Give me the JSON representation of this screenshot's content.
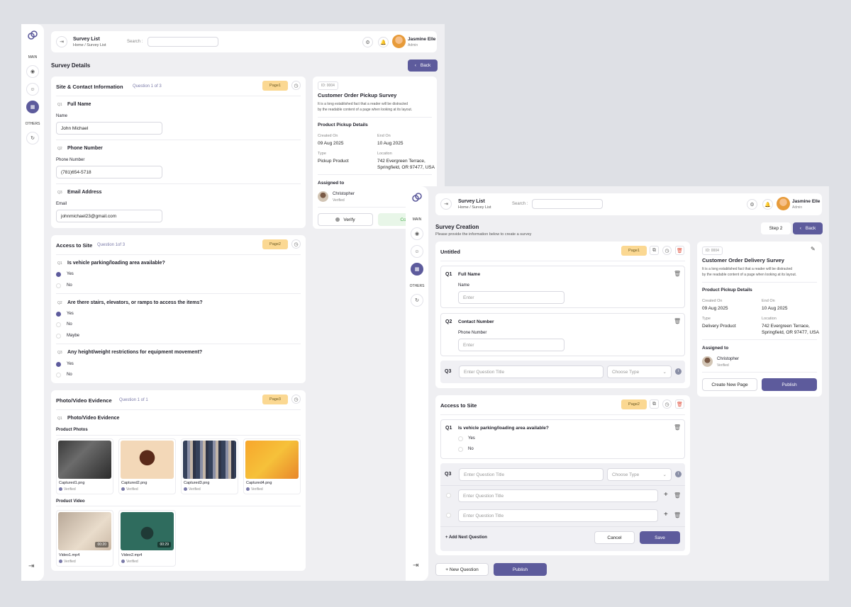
{
  "w1": {
    "topbar": {
      "title": "Survey List",
      "crumb_home": "Home",
      "crumb_sep": "/",
      "crumb_current": "Survey List",
      "search_label": "Search :",
      "user_name": "Jasmine Elle",
      "user_role": "Admin"
    },
    "sidebar": {
      "main": "MAIN",
      "others": "OTHERS"
    },
    "page_title": "Survey Details",
    "back": "Back",
    "sec1": {
      "title": "Site & Contact Information",
      "sub": "Question 1 of 3",
      "page": "Page1",
      "q1": {
        "num": "Q1",
        "title": "Full Name",
        "label": "Name",
        "value": "John Michael"
      },
      "q2": {
        "num": "Q2",
        "title": "Phone Number",
        "label": "Phone Number",
        "value": "(781)654-5718"
      },
      "q3": {
        "num": "Q3",
        "title": "Email Address",
        "label": "Email",
        "value": "johnmichael23@gmail.com"
      }
    },
    "sec2": {
      "title": "Access to Site",
      "sub": "Question 1of 3",
      "page": "Page2",
      "q1": {
        "num": "Q1",
        "title": "Is vehicle parking/loading area available?",
        "o1": "Yes",
        "o2": "No"
      },
      "q2": {
        "num": "Q2",
        "title": "Are there stairs, elevators, or ramps to access the items?",
        "o1": "Yes",
        "o2": "No",
        "o3": "Maybe"
      },
      "q3": {
        "num": "Q3",
        "title": "Any height/weight restrictions for equipment movement?",
        "o1": "Yes",
        "o2": "No"
      }
    },
    "sec3": {
      "title": "Photo/Video Evidence",
      "sub": "Question 1 of 1",
      "page": "Page3",
      "q1": {
        "num": "Q1",
        "title": "Photo/Video Evidence"
      },
      "photos_label": "Product Photos",
      "photos": [
        {
          "name": "Captured1.png",
          "status": "Verified"
        },
        {
          "name": "Captured2.png",
          "status": "Verified"
        },
        {
          "name": "Captured3.png",
          "status": "Verified"
        },
        {
          "name": "Captured4.png",
          "status": "Verified"
        }
      ],
      "video_label": "Product Video",
      "videos": [
        {
          "name": "Video1.mp4",
          "status": "Verified",
          "dur": "00:20"
        },
        {
          "name": "Video2.mp4",
          "status": "Verified",
          "dur": "00:29"
        }
      ]
    },
    "info": {
      "id": "ID: 0004",
      "title": "Customer Order Pickup Survey",
      "desc1": "It is a long established fact that a reader will be distracted",
      "desc2": "by the readable content of a page when looking at its layout.",
      "details": "Product Pickup Details",
      "created_label": "Created On",
      "created": "09 Aug 2025",
      "end_label": "End On",
      "end": "10 Aug 2025",
      "type_label": "Type",
      "type": "Pickup Product",
      "loc_label": "Location",
      "loc1": "742 Evergreen Terrace,",
      "loc2": "Springfield, OR 97477, USA",
      "assigned": "Assigned to",
      "person": "Christopher",
      "person_status": "Verified",
      "verify": "Verify",
      "complete": "Comp"
    }
  },
  "w2": {
    "topbar": {
      "title": "Survey List",
      "crumb_home": "Home",
      "crumb_sep": "/",
      "crumb_current": "Survey List",
      "search_label": "Search :",
      "user_name": "Jasmine Elle",
      "user_role": "Admin"
    },
    "sidebar": {
      "main": "MAIN",
      "others": "OTHERS"
    },
    "page_title": "Survey Creation",
    "page_sub": "Please provide the information below to create a survey",
    "step": "Step 2",
    "back": "Back",
    "sec1": {
      "title": "Untitled",
      "page": "Page1",
      "q1": {
        "num": "Q1",
        "title": "Full Name",
        "label": "Name",
        "placeholder": "Enter"
      },
      "q2": {
        "num": "Q2",
        "title": "Contact Number",
        "label": "Phone Number",
        "placeholder": "Enter"
      },
      "q3": {
        "num": "Q3",
        "placeholder": "Enter Question Title",
        "type": "Choose Type"
      }
    },
    "sec2": {
      "title": "Access to Site",
      "page": "Page2",
      "q1": {
        "num": "Q1",
        "title": "Is vehicle parking/loading area available?",
        "o1": "Yes",
        "o2": "No"
      },
      "q3": {
        "num": "Q3",
        "placeholder": "Enter Question Title",
        "type": "Choose Type",
        "opt1": "Enter Question Title",
        "opt2": "Enter Question Title"
      },
      "add_next": "+ Add Next Question",
      "cancel": "Cancel",
      "save": "Save"
    },
    "new_question": "+ New Question",
    "publish": "Publish",
    "info": {
      "id": "ID: 0004",
      "title": "Customer Order Delivery Survey",
      "desc1": "It is a long established fact that a reader will be distracted",
      "desc2": "by the readable content of a page when looking at its layout.",
      "details": "Product Pickup Details",
      "created_label": "Created On",
      "created": "09 Aug 2025",
      "end_label": "End On",
      "end": "10 Aug 2025",
      "type_label": "Type",
      "type": "Delivery Product",
      "loc_label": "Location",
      "loc1": "742 Evergreen Terrace,",
      "loc2": "Springfield, OR 97477, USA",
      "assigned": "Assigned to",
      "person": "Christopher",
      "person_status": "Verified",
      "create_page": "Create New Page",
      "publish": "Publish"
    }
  }
}
